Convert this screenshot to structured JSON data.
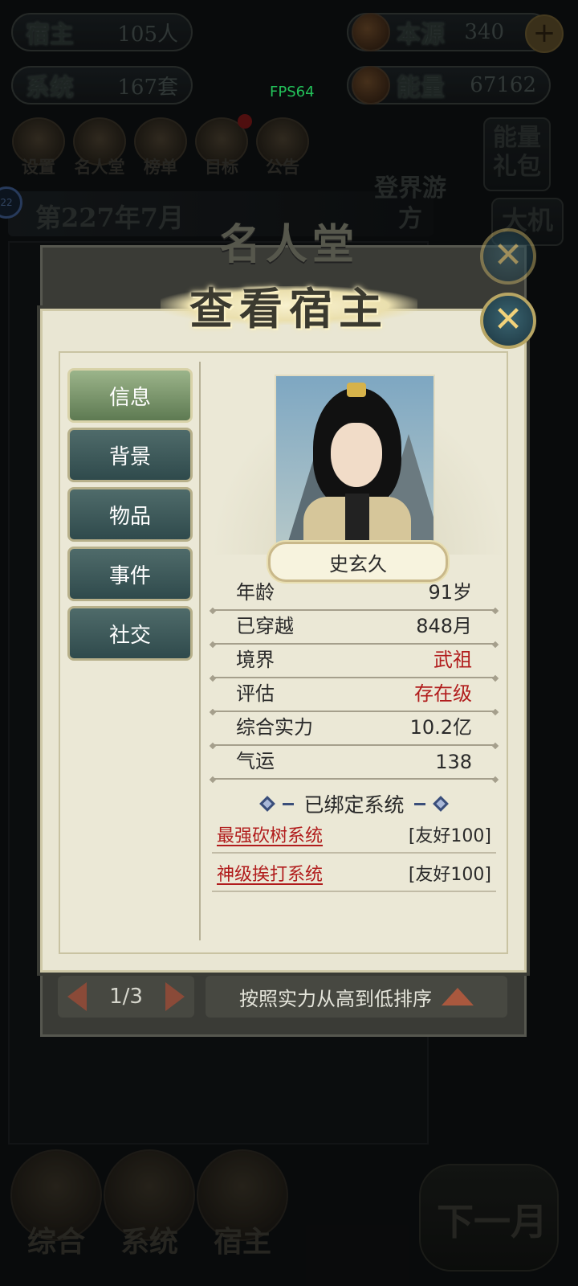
{
  "hud": {
    "host_label": "宿主",
    "host_value": "105人",
    "system_label": "系统",
    "system_value": "167套",
    "origin_label": "本源",
    "origin_value": "340",
    "energy_label": "能量",
    "energy_value": "67162",
    "fps": "FPS64"
  },
  "top_icons": [
    "设置",
    "名人堂",
    "榜单",
    "目标",
    "公告"
  ],
  "side_buttons": [
    "能量礼包",
    "大机"
  ],
  "adventure": "登界游方",
  "date": "第227年7月",
  "hall": {
    "title": "名人堂",
    "pager": "1/3",
    "sort": "按照实力从高到低排序"
  },
  "modal": {
    "title": "查看宿主",
    "close_glyph": "✕",
    "tabs": [
      "信息",
      "背景",
      "物品",
      "事件",
      "社交"
    ],
    "active_tab": 0,
    "name": "史玄久",
    "attributes": [
      {
        "label": "年龄",
        "value": "91岁"
      },
      {
        "label": "已穿越",
        "value": "848月"
      },
      {
        "label": "境界",
        "value": "武祖"
      },
      {
        "label": "评估",
        "value": "存在级"
      },
      {
        "label": "综合实力",
        "value": "10.2亿"
      },
      {
        "label": "气运",
        "value": "138"
      }
    ],
    "bound_title": "已绑定系统",
    "systems": [
      {
        "name": "最强砍树系统",
        "tag": "[友好100]"
      },
      {
        "name": "神级挨打系统",
        "tag": "[友好100]"
      }
    ]
  },
  "bottom_nav": [
    "综合",
    "系统",
    "宿主"
  ],
  "next_month": "下一月",
  "colors": {
    "modal_bg": "#e9e6d3",
    "tab_active": "#7f9a6e",
    "tab": "#3f5b5c",
    "red_text": "#b11c1c"
  }
}
